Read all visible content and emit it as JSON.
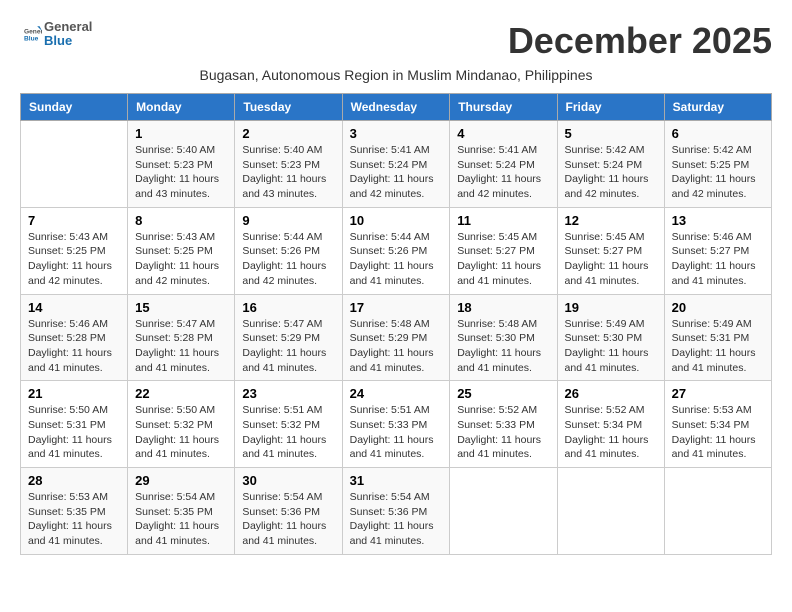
{
  "header": {
    "logo_general": "General",
    "logo_blue": "Blue",
    "month_title": "December 2025",
    "subtitle": "Bugasan, Autonomous Region in Muslim Mindanao, Philippines"
  },
  "days_of_week": [
    "Sunday",
    "Monday",
    "Tuesday",
    "Wednesday",
    "Thursday",
    "Friday",
    "Saturday"
  ],
  "weeks": [
    [
      {
        "day": "",
        "info": ""
      },
      {
        "day": "1",
        "info": "Sunrise: 5:40 AM\nSunset: 5:23 PM\nDaylight: 11 hours\nand 43 minutes."
      },
      {
        "day": "2",
        "info": "Sunrise: 5:40 AM\nSunset: 5:23 PM\nDaylight: 11 hours\nand 43 minutes."
      },
      {
        "day": "3",
        "info": "Sunrise: 5:41 AM\nSunset: 5:24 PM\nDaylight: 11 hours\nand 42 minutes."
      },
      {
        "day": "4",
        "info": "Sunrise: 5:41 AM\nSunset: 5:24 PM\nDaylight: 11 hours\nand 42 minutes."
      },
      {
        "day": "5",
        "info": "Sunrise: 5:42 AM\nSunset: 5:24 PM\nDaylight: 11 hours\nand 42 minutes."
      },
      {
        "day": "6",
        "info": "Sunrise: 5:42 AM\nSunset: 5:25 PM\nDaylight: 11 hours\nand 42 minutes."
      }
    ],
    [
      {
        "day": "7",
        "info": "Sunrise: 5:43 AM\nSunset: 5:25 PM\nDaylight: 11 hours\nand 42 minutes."
      },
      {
        "day": "8",
        "info": "Sunrise: 5:43 AM\nSunset: 5:25 PM\nDaylight: 11 hours\nand 42 minutes."
      },
      {
        "day": "9",
        "info": "Sunrise: 5:44 AM\nSunset: 5:26 PM\nDaylight: 11 hours\nand 42 minutes."
      },
      {
        "day": "10",
        "info": "Sunrise: 5:44 AM\nSunset: 5:26 PM\nDaylight: 11 hours\nand 41 minutes."
      },
      {
        "day": "11",
        "info": "Sunrise: 5:45 AM\nSunset: 5:27 PM\nDaylight: 11 hours\nand 41 minutes."
      },
      {
        "day": "12",
        "info": "Sunrise: 5:45 AM\nSunset: 5:27 PM\nDaylight: 11 hours\nand 41 minutes."
      },
      {
        "day": "13",
        "info": "Sunrise: 5:46 AM\nSunset: 5:27 PM\nDaylight: 11 hours\nand 41 minutes."
      }
    ],
    [
      {
        "day": "14",
        "info": "Sunrise: 5:46 AM\nSunset: 5:28 PM\nDaylight: 11 hours\nand 41 minutes."
      },
      {
        "day": "15",
        "info": "Sunrise: 5:47 AM\nSunset: 5:28 PM\nDaylight: 11 hours\nand 41 minutes."
      },
      {
        "day": "16",
        "info": "Sunrise: 5:47 AM\nSunset: 5:29 PM\nDaylight: 11 hours\nand 41 minutes."
      },
      {
        "day": "17",
        "info": "Sunrise: 5:48 AM\nSunset: 5:29 PM\nDaylight: 11 hours\nand 41 minutes."
      },
      {
        "day": "18",
        "info": "Sunrise: 5:48 AM\nSunset: 5:30 PM\nDaylight: 11 hours\nand 41 minutes."
      },
      {
        "day": "19",
        "info": "Sunrise: 5:49 AM\nSunset: 5:30 PM\nDaylight: 11 hours\nand 41 minutes."
      },
      {
        "day": "20",
        "info": "Sunrise: 5:49 AM\nSunset: 5:31 PM\nDaylight: 11 hours\nand 41 minutes."
      }
    ],
    [
      {
        "day": "21",
        "info": "Sunrise: 5:50 AM\nSunset: 5:31 PM\nDaylight: 11 hours\nand 41 minutes."
      },
      {
        "day": "22",
        "info": "Sunrise: 5:50 AM\nSunset: 5:32 PM\nDaylight: 11 hours\nand 41 minutes."
      },
      {
        "day": "23",
        "info": "Sunrise: 5:51 AM\nSunset: 5:32 PM\nDaylight: 11 hours\nand 41 minutes."
      },
      {
        "day": "24",
        "info": "Sunrise: 5:51 AM\nSunset: 5:33 PM\nDaylight: 11 hours\nand 41 minutes."
      },
      {
        "day": "25",
        "info": "Sunrise: 5:52 AM\nSunset: 5:33 PM\nDaylight: 11 hours\nand 41 minutes."
      },
      {
        "day": "26",
        "info": "Sunrise: 5:52 AM\nSunset: 5:34 PM\nDaylight: 11 hours\nand 41 minutes."
      },
      {
        "day": "27",
        "info": "Sunrise: 5:53 AM\nSunset: 5:34 PM\nDaylight: 11 hours\nand 41 minutes."
      }
    ],
    [
      {
        "day": "28",
        "info": "Sunrise: 5:53 AM\nSunset: 5:35 PM\nDaylight: 11 hours\nand 41 minutes."
      },
      {
        "day": "29",
        "info": "Sunrise: 5:54 AM\nSunset: 5:35 PM\nDaylight: 11 hours\nand 41 minutes."
      },
      {
        "day": "30",
        "info": "Sunrise: 5:54 AM\nSunset: 5:36 PM\nDaylight: 11 hours\nand 41 minutes."
      },
      {
        "day": "31",
        "info": "Sunrise: 5:54 AM\nSunset: 5:36 PM\nDaylight: 11 hours\nand 41 minutes."
      },
      {
        "day": "",
        "info": ""
      },
      {
        "day": "",
        "info": ""
      },
      {
        "day": "",
        "info": ""
      }
    ]
  ]
}
